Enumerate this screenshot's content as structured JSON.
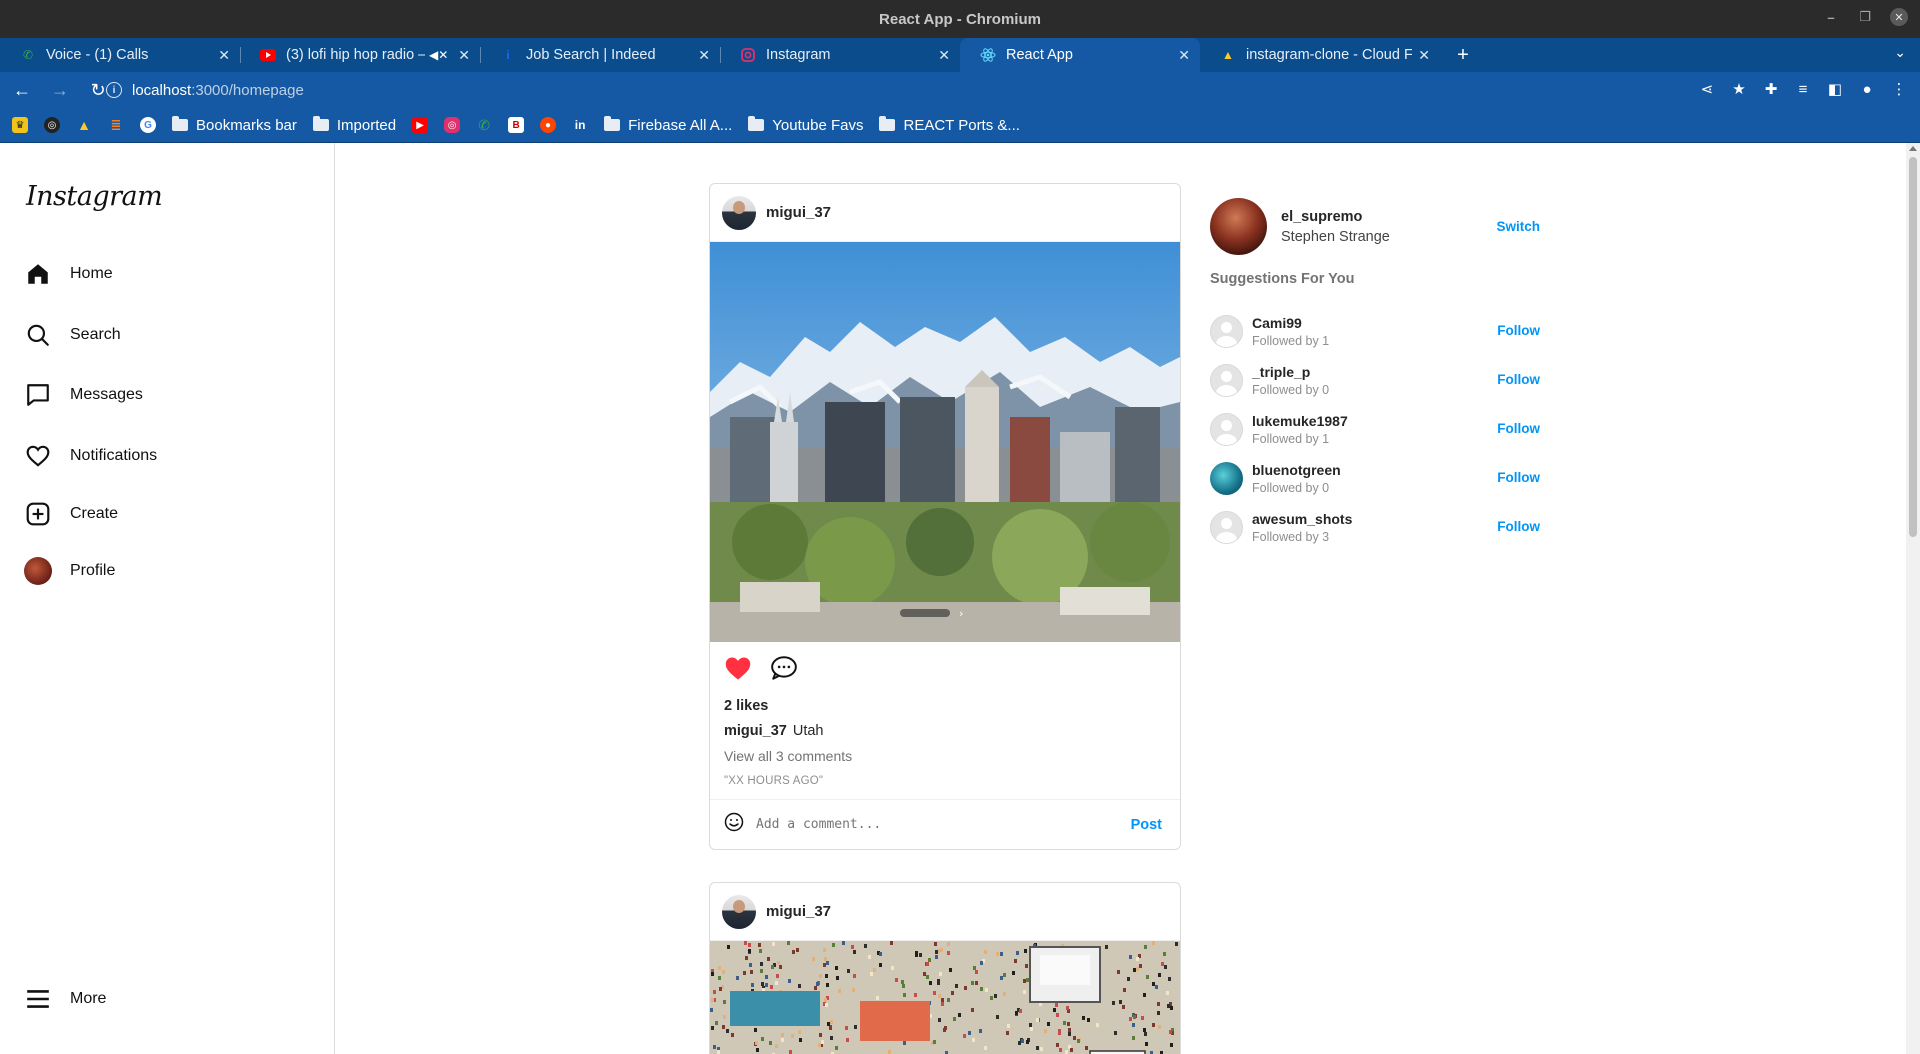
{
  "window": {
    "title": "React App - Chromium"
  },
  "tabs": [
    {
      "title": "Voice - (1) Calls",
      "icon": "phone-icon",
      "color": "#34a853"
    },
    {
      "title": "(3) lofi hip hop radio –",
      "icon": "youtube-icon",
      "color": "#ff0000"
    },
    {
      "title": "Job Search | Indeed",
      "icon": "indeed-icon",
      "color": "#2164f3"
    },
    {
      "title": "Instagram",
      "icon": "instagram-icon",
      "color": "#e1306c"
    },
    {
      "title": "React App",
      "icon": "react-icon",
      "color": "#61dafb"
    },
    {
      "title": "instagram-clone - Cloud F",
      "icon": "firebase-icon",
      "color": "#ffca28"
    }
  ],
  "address": {
    "host": "localhost",
    "path": ":3000/homepage"
  },
  "bookmarks": {
    "folders": [
      "Bookmarks bar",
      "Imported",
      "Firebase All A...",
      "Youtube Favs",
      "REACT Ports &..."
    ]
  },
  "sidebar": {
    "logo": "Instagram",
    "items": [
      {
        "label": "Home",
        "icon": "home-icon"
      },
      {
        "label": "Search",
        "icon": "search-icon"
      },
      {
        "label": "Messages",
        "icon": "messages-icon"
      },
      {
        "label": "Notifications",
        "icon": "heart-icon"
      },
      {
        "label": "Create",
        "icon": "create-icon"
      },
      {
        "label": "Profile",
        "icon": "profile-avatar"
      }
    ],
    "more": "More"
  },
  "posts": [
    {
      "username": "migui_37",
      "likes": "2 likes",
      "caption_user": "migui_37",
      "caption_text": "Utah",
      "view_comments": "View all 3 comments",
      "timestamp": "\"XX HOURS AGO\"",
      "comment_placeholder": "Add a comment...",
      "post_label": "Post",
      "liked": true
    },
    {
      "username": "migui_37"
    }
  ],
  "current_user": {
    "username": "el_supremo",
    "full_name": "Stephen Strange",
    "switch_label": "Switch"
  },
  "suggestions": {
    "heading": "Suggestions For You",
    "items": [
      {
        "username": "Cami99",
        "followed_by": "Followed by 1",
        "action": "Follow"
      },
      {
        "username": "_triple_p",
        "followed_by": "Followed by 0",
        "action": "Follow"
      },
      {
        "username": "lukemuke1987",
        "followed_by": "Followed by 1",
        "action": "Follow"
      },
      {
        "username": "bluenotgreen",
        "followed_by": "Followed by 0",
        "action": "Follow"
      },
      {
        "username": "awesum_shots",
        "followed_by": "Followed by 3",
        "action": "Follow"
      }
    ]
  },
  "colors": {
    "chrome_blue": "#1559a4",
    "tab_strip": "#0a4c8c",
    "link_blue": "#0095f6",
    "like_red": "#ff3040"
  }
}
